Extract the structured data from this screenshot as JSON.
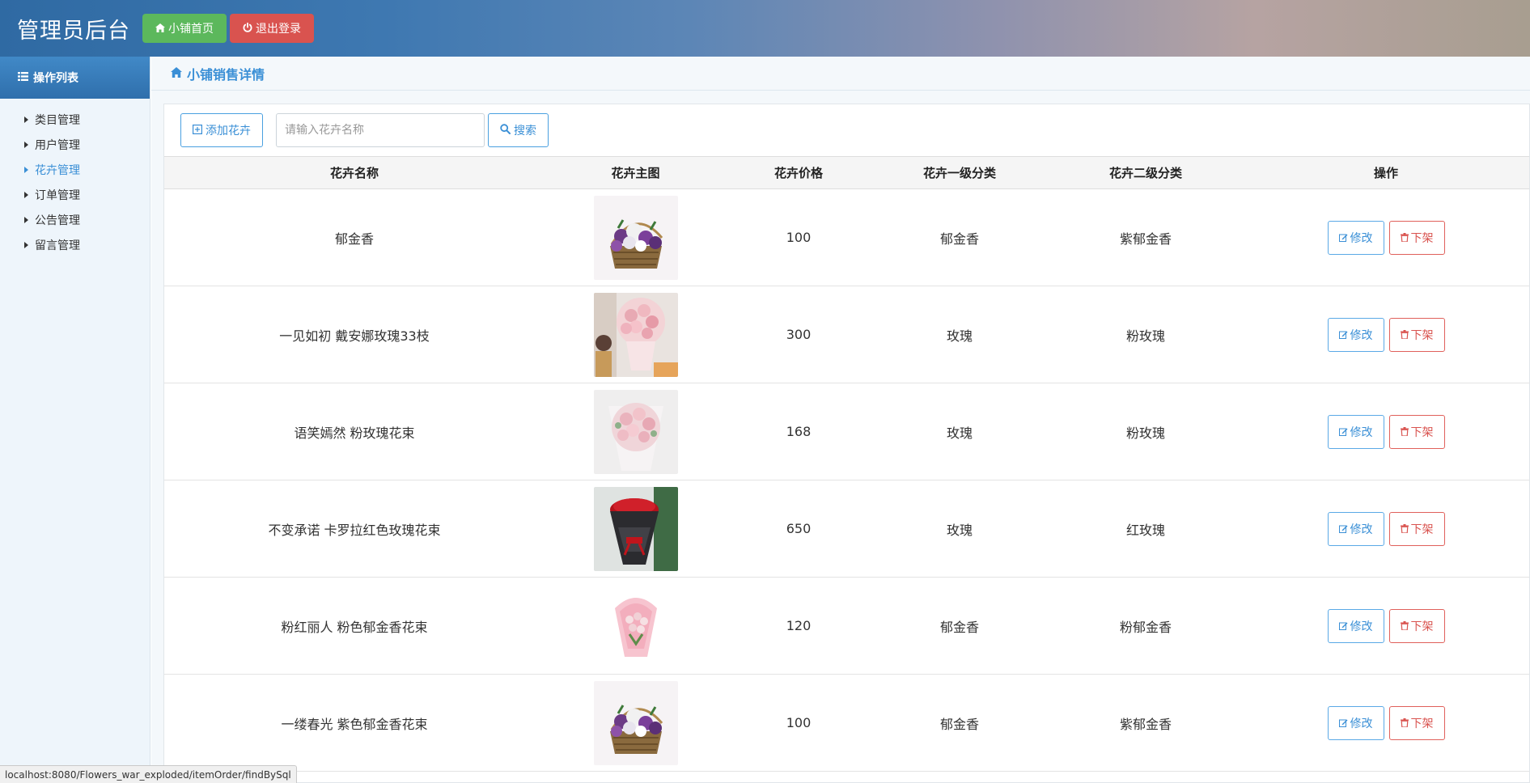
{
  "header": {
    "title": "管理员后台",
    "home_button": "小铺首页",
    "logout_button": "退出登录"
  },
  "sidebar": {
    "heading": "操作列表",
    "items": [
      {
        "label": "类目管理",
        "active": false
      },
      {
        "label": "用户管理",
        "active": false
      },
      {
        "label": "花卉管理",
        "active": true
      },
      {
        "label": "订单管理",
        "active": false
      },
      {
        "label": "公告管理",
        "active": false
      },
      {
        "label": "留言管理",
        "active": false
      }
    ]
  },
  "main": {
    "breadcrumb": "小铺销售详情",
    "toolbar": {
      "add_button": "添加花卉",
      "search_placeholder": "请输入花卉名称",
      "search_button": "搜索"
    },
    "table": {
      "columns": [
        "花卉名称",
        "花卉主图",
        "花卉价格",
        "花卉一级分类",
        "花卉二级分类",
        "操作"
      ],
      "rows": [
        {
          "name": "郁金香",
          "image": "purple-tulip-basket",
          "price": "100",
          "cat1": "郁金香",
          "cat2": "紫郁金香",
          "edit": "修改",
          "remove": "下架"
        },
        {
          "name": "一见如初 戴安娜玫瑰33枝",
          "image": "pink-rose-bouquet-held",
          "price": "300",
          "cat1": "玫瑰",
          "cat2": "粉玫瑰",
          "edit": "修改",
          "remove": "下架"
        },
        {
          "name": "语笑嫣然 粉玫瑰花束",
          "image": "pink-rose-bouquet",
          "price": "168",
          "cat1": "玫瑰",
          "cat2": "粉玫瑰",
          "edit": "修改",
          "remove": "下架"
        },
        {
          "name": "不变承诺 卡罗拉红色玫瑰花束",
          "image": "red-rose-bouquet",
          "price": "650",
          "cat1": "玫瑰",
          "cat2": "红玫瑰",
          "edit": "修改",
          "remove": "下架"
        },
        {
          "name": "粉红丽人 粉色郁金香花束",
          "image": "pink-tulip-bouquet",
          "price": "120",
          "cat1": "郁金香",
          "cat2": "粉郁金香",
          "edit": "修改",
          "remove": "下架"
        },
        {
          "name": "一缕春光 紫色郁金香花束",
          "image": "purple-tulip-basket",
          "price": "100",
          "cat1": "郁金香",
          "cat2": "紫郁金香",
          "edit": "修改",
          "remove": "下架"
        }
      ]
    }
  },
  "statusbar": {
    "url": "localhost:8080/Flowers_war_exploded/itemOrder/findBySql"
  },
  "colors": {
    "accent": "#3a8fd6",
    "success": "#5cb85c",
    "danger": "#d9534f"
  }
}
